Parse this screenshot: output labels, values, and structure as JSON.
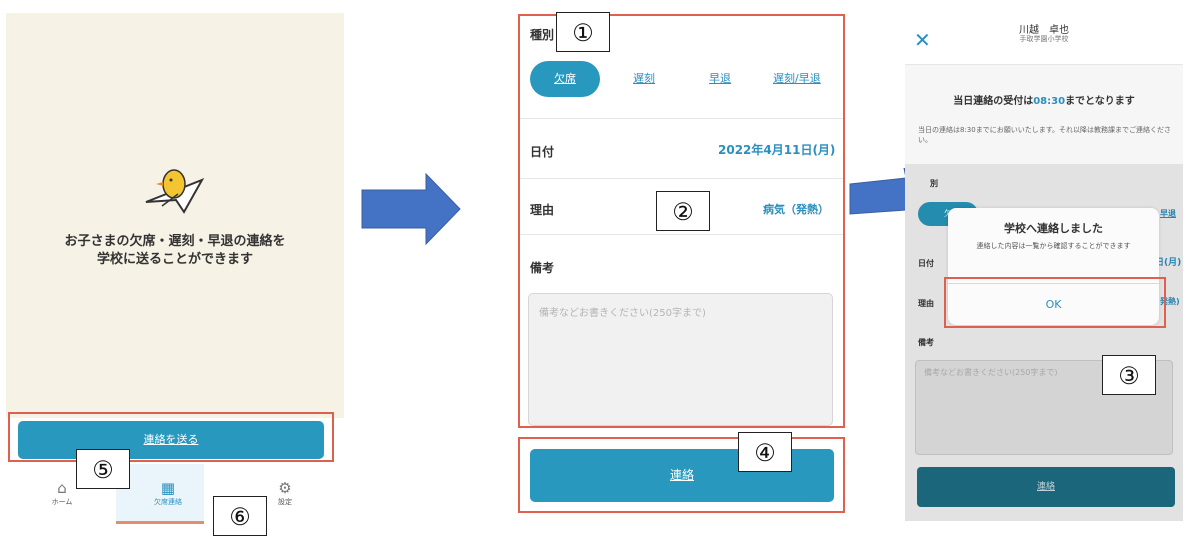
{
  "screen1": {
    "message": "お子さまの欠席・遅刻・早退の連絡を\n学校に送ることができます",
    "send_button": "連絡を送る",
    "nav": [
      {
        "label": "ホーム",
        "icon": "home-icon",
        "glyph": "⌂"
      },
      {
        "label": "欠席連絡",
        "icon": "desk-icon",
        "glyph": "▦"
      },
      {
        "label": "設定",
        "icon": "gear-icon",
        "glyph": "⚙"
      }
    ]
  },
  "screen2": {
    "type_label": "種別",
    "tabs": [
      {
        "label": "欠席",
        "active": true
      },
      {
        "label": "遅刻",
        "active": false
      },
      {
        "label": "早退",
        "active": false
      },
      {
        "label": "遅刻/早退",
        "active": false
      }
    ],
    "date_label": "日付",
    "date_value": "2022年4月11日(月)",
    "reason_label": "理由",
    "reason_value": "病気（発熱）",
    "remarks_label": "備考",
    "remarks_placeholder": "備考などお書きください(250字まで)",
    "submit_button": "連絡"
  },
  "screen3": {
    "close_glyph": "✕",
    "student_name": "川越　卓也",
    "school_name": "手取学園小学校",
    "deadline_prefix": "当日連絡の受付は",
    "deadline_time": "08:30",
    "deadline_suffix": "までとなります",
    "deadline_note": "当日の連絡は8:30までにお願いいたします。それ以降は教務課までご連絡ください。",
    "type_label_partial": "別",
    "tab_partial_left": "欠",
    "tab_partial_right": "早退",
    "date_label": "日付",
    "date_partial": "日(月)",
    "reason_label": "理由",
    "reason_partial": "発熱)",
    "remarks_label": "備考",
    "remarks_placeholder": "備考などお書きください(250字まで)",
    "submit_button": "連絡",
    "modal": {
      "title": "学校へ連絡しました",
      "body": "連絡した内容は一覧から確認することができます",
      "ok": "OK"
    }
  },
  "callouts": [
    "①",
    "②",
    "③",
    "④",
    "⑤",
    "⑥"
  ],
  "colors": {
    "primary": "#2898be",
    "accent_text": "#2a8fc0",
    "highlight": "#e0604f",
    "arrow": "#4472c4",
    "screen1_bg": "#f7f2e6"
  }
}
